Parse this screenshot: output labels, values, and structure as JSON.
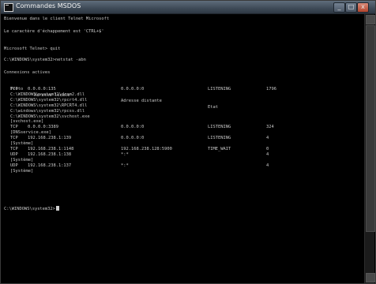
{
  "window": {
    "title": "Commandes MSDOS",
    "minimize_glyph": "_",
    "maximize_glyph": "□",
    "close_glyph": "x",
    "icon": "cmd-icon"
  },
  "console": {
    "banner": "Bienvenue dans le client Telnet Microsoft",
    "escape_line": "Le caractère d'échappement est 'CTRL+$'",
    "telnet_prompt": "Microsoft Telnet> quit",
    "cmd_netstat": "C:\\WINDOWS\\system32>netstat -abn",
    "connections_header": "Connexions actives",
    "headers": [
      "Proto",
      "Adresse locale",
      "Adresse distante",
      "Etat"
    ],
    "rows": [
      {
        "proto": "TCP",
        "local": "0.0.0.0:135",
        "remote": "0.0.0.0:0",
        "state": "LISTENING",
        "pid": "1796"
      },
      {
        "detail": "C:\\WINDOWS\\system32\\dcom2.dll"
      },
      {
        "detail": "C:\\WINDOWS\\system32\\rpcrt4.dll"
      },
      {
        "detail": "C:\\WINDOWS\\system32\\RPCRT4.dll"
      },
      {
        "detail": "C:\\windows\\system32\\rpcss.dll"
      },
      {
        "detail": "C:\\WINDOWS\\system32\\svchost.exe"
      },
      {
        "detail": "[svchost.exe]"
      },
      {
        "proto": "TCP",
        "local": "0.0.0.0:3389",
        "remote": "0.0.0.0:0",
        "state": "LISTENING",
        "pid": "324"
      },
      {
        "detail": "[DNSservice.exe]"
      },
      {
        "proto": "TCP",
        "local": "192.168.238.1:139",
        "remote": "0.0.0.0:0",
        "state": "LISTENING",
        "pid": "4"
      },
      {
        "detail": "[Système]"
      },
      {
        "proto": "TCP",
        "local": "192.168.238.1:1148",
        "remote": "192.168.238.128:5900",
        "state": "TIME_WAIT",
        "pid": "0"
      },
      {
        "proto": "UDP",
        "local": "192.168.238.1:138",
        "remote": "*:*",
        "state": "",
        "pid": "4"
      },
      {
        "detail": "[Système]"
      },
      {
        "proto": "UDP",
        "local": "192.168.238.1:137",
        "remote": "*:*",
        "state": "",
        "pid": "4"
      },
      {
        "detail": "[Système]"
      }
    ],
    "final_prompt": "C:\\WINDOWS\\system32>"
  },
  "colors": {
    "background": "#000000",
    "text": "#c8c8c8",
    "titlebar": "#3e4a57"
  }
}
